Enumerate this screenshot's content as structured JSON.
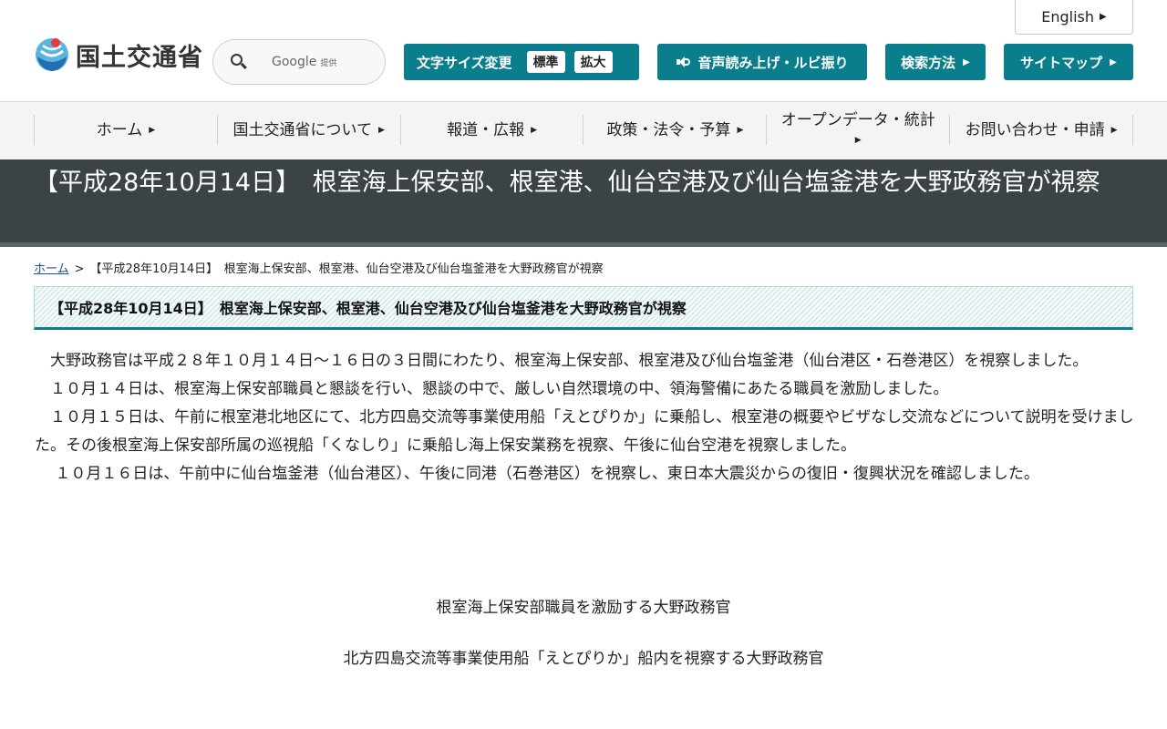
{
  "header": {
    "english_label": "English",
    "logo_text": "国土交通省",
    "search": {
      "brand": "Google",
      "brand_suffix": "提供"
    },
    "font_size": {
      "label": "文字サイズ変更",
      "options": [
        "標準",
        "拡大"
      ]
    },
    "voice_label": "音声読み上げ・ルビ振り",
    "search_method_label": "検索方法",
    "sitemap_label": "サイトマップ"
  },
  "nav": {
    "items": [
      {
        "label": "ホーム"
      },
      {
        "label": "国土交通省について"
      },
      {
        "label": "報道・広報"
      },
      {
        "label": "政策・法令・予算"
      },
      {
        "label": "オープンデータ・統計"
      },
      {
        "label": "お問い合わせ・申請"
      }
    ]
  },
  "page": {
    "title": "【平成28年10月14日】　根室海上保安部、根室港、仙台空港及び仙台塩釜港を大野政務官が視察",
    "breadcrumb": {
      "home": "ホーム",
      "separator": ">",
      "current": "【平成28年10月14日】　根室海上保安部、根室港、仙台空港及び仙台塩釜港を大野政務官が視察"
    },
    "section_heading": "【平成28年10月14日】　根室海上保安部、根室港、仙台空港及び仙台塩釜港を大野政務官が視察",
    "paragraphs": [
      "　大野政務官は平成２８年１０月１４日～１６日の３日間にわたり、根室海上保安部、根室港及び仙台塩釜港（仙台港区・石巻港区）を視察しました。",
      "　１０月１４日は、根室海上保安部職員と懇談を行い、懇談の中で、厳しい自然環境の中、領海警備にあたる職員を激励しました。",
      "　１０月１５日は、午前に根室港北地区にて、北方四島交流等事業使用船「えとぴりか」に乗船し、根室港の概要やビザなし交流などについて説明を受けました。その後根室海上保安部所属の巡視船「くなしり」に乗船し海上保安業務を視察、午後に仙台空港を視察しました。",
      "　 １０月１６日は、午前中に仙台塩釜港（仙台港区）、午後に同港（石巻港区）を視察し、東日本大震災からの復旧・復興状況を確認しました。"
    ],
    "captions": [
      "根室海上保安部職員を激励する大野政務官",
      "北方四島交流等事業使用船「えとぴりか」船内を視察する大野政務官"
    ]
  },
  "colors": {
    "accent": "#0a7e8c",
    "title_band": "#3b4347",
    "nav_bg": "#f4f4f4",
    "link": "#1a4fa0"
  }
}
